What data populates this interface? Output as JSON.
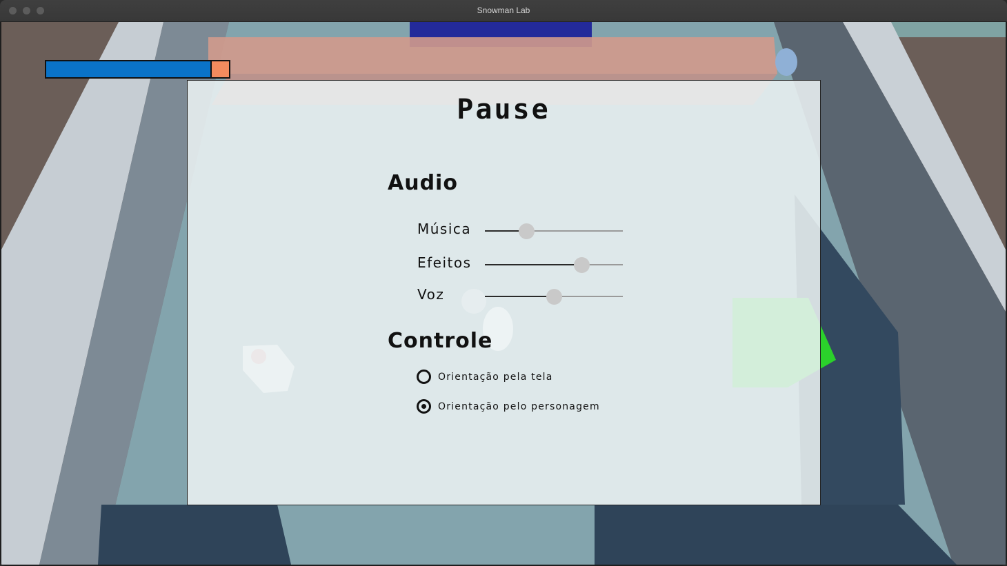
{
  "window": {
    "title": "Snowman Lab"
  },
  "hud": {
    "health_fraction": 0.905
  },
  "pause_menu": {
    "title": "Pause",
    "audio": {
      "heading": "Audio",
      "sliders": [
        {
          "label": "Música",
          "value": 0.3
        },
        {
          "label": "Efeitos",
          "value": 0.7
        },
        {
          "label": "Voz",
          "value": 0.5
        }
      ]
    },
    "controls": {
      "heading": "Controle",
      "options": [
        {
          "label": "Orientação pela tela",
          "selected": false
        },
        {
          "label": "Orientação pelo personagem",
          "selected": true
        }
      ]
    }
  },
  "colors": {
    "health_fill": "#0a73c8",
    "health_empty": "#f28b5e",
    "floor": "#83a4ad",
    "wall_shadow": "#2f4459",
    "green_cube": "#2bd12b"
  }
}
